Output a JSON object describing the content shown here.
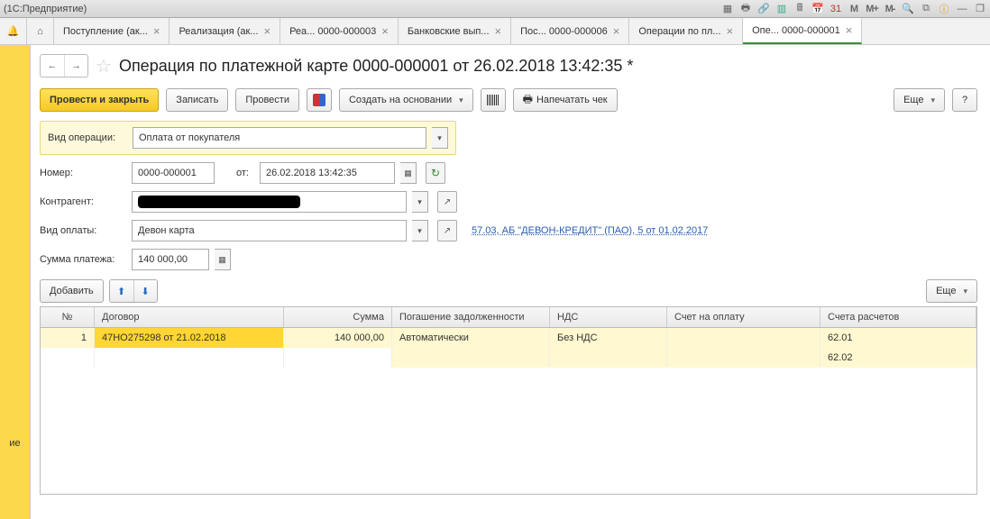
{
  "window": {
    "title": "(1С:Предприятие)"
  },
  "tabs": [
    {
      "label": "Поступление (ак...",
      "active": false
    },
    {
      "label": "Реализация (ак...",
      "active": false
    },
    {
      "label": "Реа... 0000-000003",
      "active": false
    },
    {
      "label": "Банковские вып...",
      "active": false
    },
    {
      "label": "Пос... 0000-000006",
      "active": false
    },
    {
      "label": "Операции по пл...",
      "active": false
    },
    {
      "label": "Опе... 0000-000001",
      "active": true
    }
  ],
  "page": {
    "title": "Операция по платежной карте 0000-000001 от 26.02.2018 13:42:35 *"
  },
  "toolbar": {
    "post_close": "Провести и закрыть",
    "save": "Записать",
    "post": "Провести",
    "create_based": "Создать на основании",
    "print_check": "Напечатать чек",
    "more": "Еще",
    "help": "?"
  },
  "form": {
    "op_type_label": "Вид операции:",
    "op_type_value": "Оплата от покупателя",
    "number_label": "Номер:",
    "number_value": "0000-000001",
    "from_label": "от:",
    "date_value": "26.02.2018 13:42:35",
    "counterparty_label": "Контрагент:",
    "counterparty_value": "",
    "pay_type_label": "Вид оплаты:",
    "pay_type_value": "Девон карта",
    "pay_link": "57.03, АБ \"ДЕВОН-КРЕДИТ\" (ПАО), 5 от 01.02.2017",
    "amount_label": "Сумма платежа:",
    "amount_value": "140 000,00"
  },
  "tableToolbar": {
    "add": "Добавить",
    "more": "Еще"
  },
  "columns": {
    "n": "№",
    "contract": "Договор",
    "sum": "Сумма",
    "pog": "Погашение задолженности",
    "nds": "НДС",
    "sch": "Счет на оплату",
    "acc": "Счета расчетов"
  },
  "rows": [
    {
      "n": "1",
      "contract": "47НО275298 от 21.02.2018",
      "sum": "140 000,00",
      "pog": "Автоматически",
      "nds": "Без НДС",
      "sch": "",
      "acc": "62.01"
    },
    {
      "acc2": "62.02"
    }
  ],
  "sidebar_cut": "ие"
}
